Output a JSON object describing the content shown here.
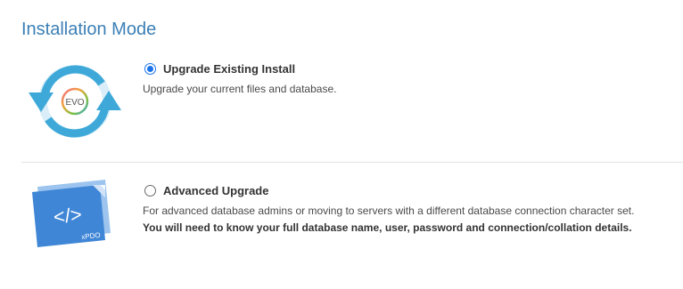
{
  "page": {
    "title": "Installation Mode"
  },
  "options": [
    {
      "label": "Upgrade Existing Install",
      "description": "Upgrade your current files and database.",
      "selected": true,
      "icon": "evo-sync-icon",
      "icon_text": "EVO"
    },
    {
      "label": "Advanced Upgrade",
      "description": "For advanced database admins or moving to servers with a different database connection character set.",
      "note": "You will need to know your full database name, user, password and connection/collation details.",
      "selected": false,
      "icon": "xpdo-code-icon",
      "icon_text": "xPDO",
      "icon_glyph": "</>"
    }
  ],
  "colors": {
    "title": "#3b7fb6",
    "accent": "#1a73e8",
    "evo_arrow": "#3ea9d9",
    "xpdo_blue": "#3f86d6"
  }
}
